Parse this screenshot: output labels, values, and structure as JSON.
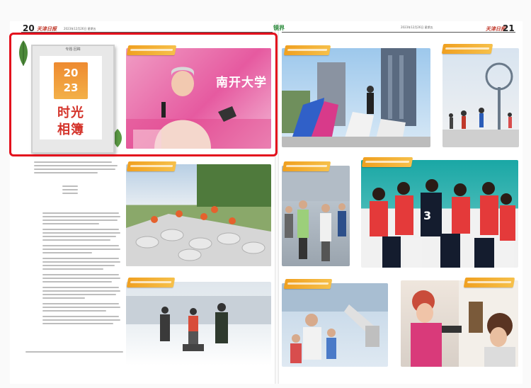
{
  "left_page": {
    "page_number": "20",
    "paper_name": "天津日报",
    "header_info": "2023年12月26日 星期五"
  },
  "right_page": {
    "page_number": "21",
    "paper_name": "天津日报",
    "header_info": "2023年12月26日 星期五",
    "section": "镜界"
  },
  "feature": {
    "frame_caption": "专题·回眸",
    "year_top": "20",
    "year_bottom": "23",
    "title_line1": "时光",
    "title_line2": "相簿"
  },
  "photos": {
    "nankai_sign": "南开大学"
  },
  "colors": {
    "highlight": "#e3101d",
    "tag": "#f0a020",
    "title_red": "#d4342b"
  }
}
